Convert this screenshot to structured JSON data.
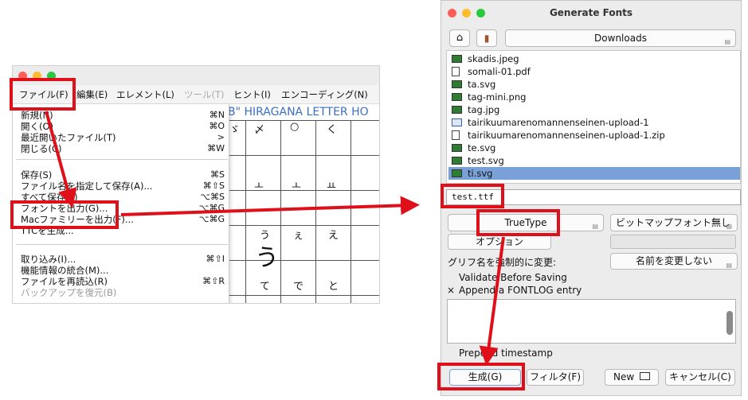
{
  "left_window": {
    "menubar": {
      "file": "ファイル(F)",
      "edit": "編集(E)",
      "element": "エレメント(L)",
      "tools": "ツール(T)",
      "hint": "ヒント(I)",
      "encoding": "エンコーディング(N)"
    },
    "glyph_title": "B\" HIRAGANA LETTER HO",
    "menu": [
      {
        "label": "新規(N)",
        "shortcut": "⌘N"
      },
      {
        "label": "開く(O)",
        "shortcut": "⌘O"
      },
      {
        "label": "最近開いたファイル(T)",
        "shortcut": ">"
      },
      {
        "label": "閉じる(C)",
        "shortcut": "⌘W"
      },
      {
        "label": "保存(S)",
        "shortcut": "⌘S"
      },
      {
        "label": "ファイル名を指定して保存(A)...",
        "shortcut": "⌘⇧S"
      },
      {
        "label": "すべて保存(L)",
        "shortcut": "⌥⌘S"
      },
      {
        "label": "フォントを出力(G)...",
        "shortcut": "⌥⌘G"
      },
      {
        "label": "Macファミリーを出力(F)...",
        "shortcut": "⌥⌘G"
      },
      {
        "label": "TTCを生成...",
        "shortcut": ""
      },
      {
        "label": "取り込み(I)...",
        "shortcut": "⌘⇧I"
      },
      {
        "label": "機能情報の統合(M)...",
        "shortcut": ""
      },
      {
        "label": "ファイルを再読込(R)",
        "shortcut": "⌘⇧R"
      },
      {
        "label": "バックアップを復元(B)",
        "shortcut": ""
      }
    ],
    "glyph_cells": [
      "ゞ",
      "〆",
      "○",
      "く",
      "ㅗ",
      "ㅗ",
      "ㅛ",
      "う",
      "ぇ",
      "え",
      "て",
      "で",
      "と"
    ],
    "big_glyph": "う"
  },
  "right_window": {
    "title": "Generate Fonts",
    "directory": "Downloads",
    "files": [
      {
        "name": "skadis.jpeg",
        "type": "image"
      },
      {
        "name": "somali-01.pdf",
        "type": "doc"
      },
      {
        "name": "ta.svg",
        "type": "image"
      },
      {
        "name": "tag-mini.png",
        "type": "image"
      },
      {
        "name": "tag.jpg",
        "type": "image"
      },
      {
        "name": "tairikuumarenomannenseinen-upload-1",
        "type": "folder"
      },
      {
        "name": "tairikuumarenomannenseinen-upload-1.zip",
        "type": "unknown"
      },
      {
        "name": "te.svg",
        "type": "image"
      },
      {
        "name": "test.svg",
        "type": "image"
      },
      {
        "name": "ti.svg",
        "type": "image",
        "selected": true
      }
    ],
    "filename": "test.ttf",
    "format": "TrueType",
    "bitmap": "ビットマップフォント無し",
    "options": "オプション",
    "force_glyph_label": "グリフ名を強制的に変更:",
    "rename": "名前を変更しない",
    "validate": "Validate Before Saving",
    "append_check": "×",
    "append": "Append a FONTLOG entry",
    "prepend": "Prepend timestamp",
    "generate": "生成(G)",
    "filter": "フィルタ(F)",
    "new": "New",
    "cancel": "キャンセル(C)"
  },
  "colors": {
    "highlight": "#e0101a",
    "selection": "#7aa0d8",
    "title_blue": "#3a6fc4"
  }
}
